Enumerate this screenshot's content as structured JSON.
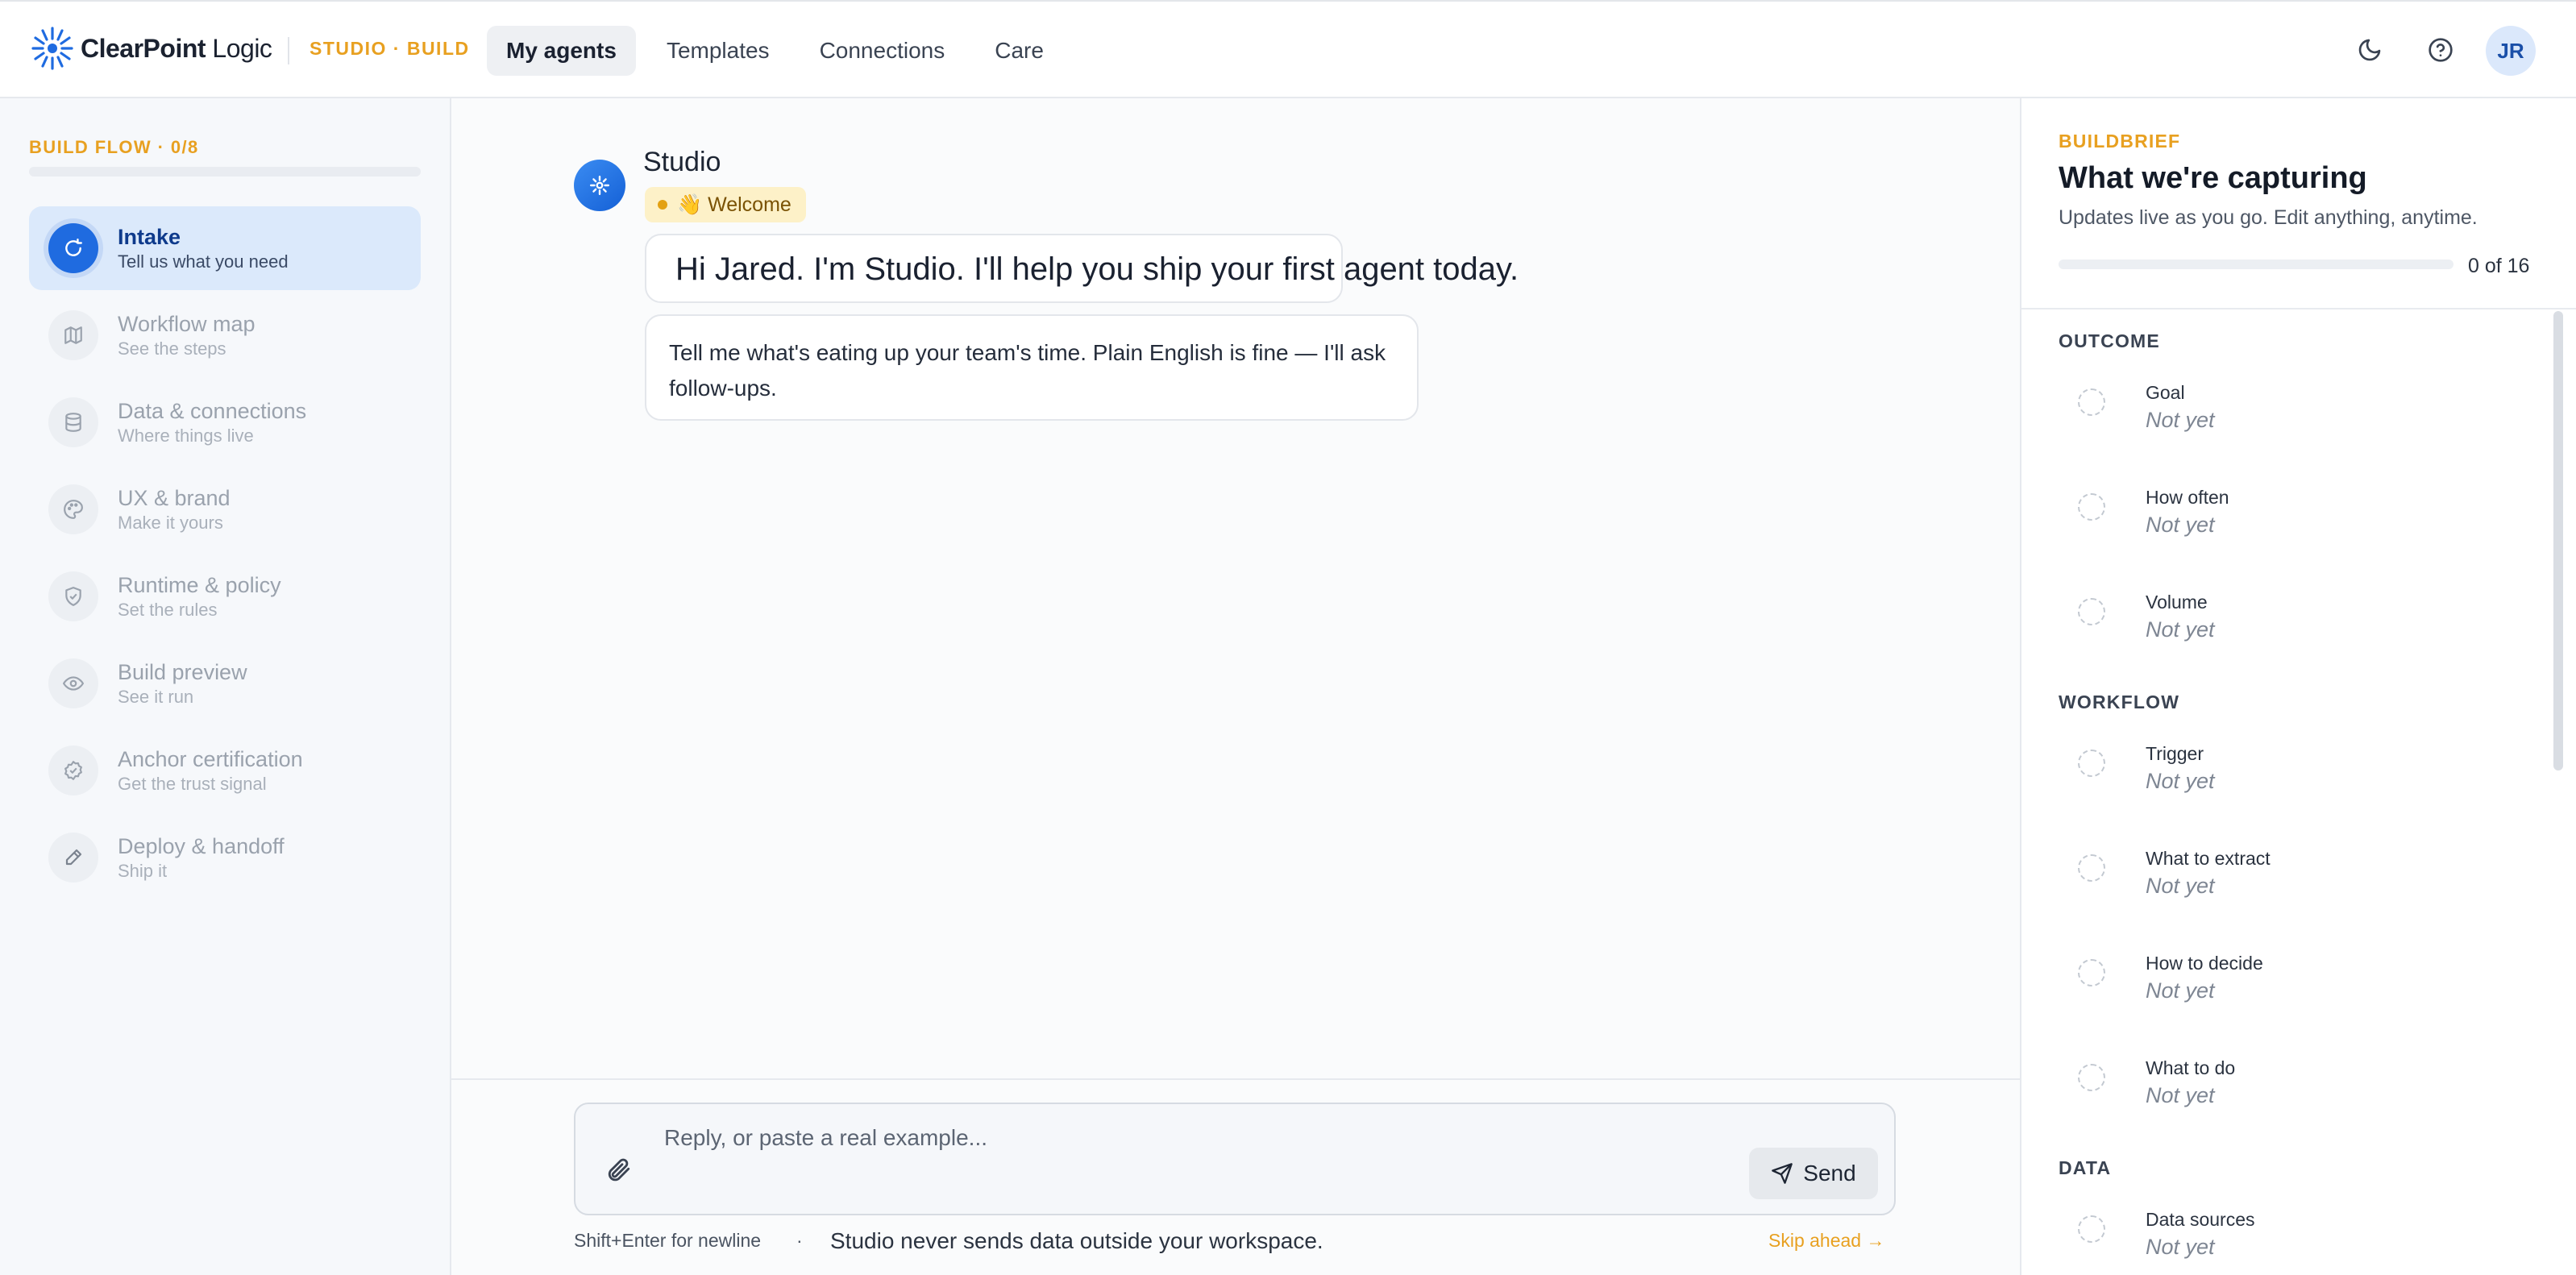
{
  "brand": {
    "name_bold": "ClearPoint",
    "name_rest": " Logic",
    "studio_tag": "STUDIO · BUILD"
  },
  "nav": {
    "tabs": [
      "My agents",
      "Templates",
      "Connections",
      "Care"
    ],
    "active": "My agents"
  },
  "user": {
    "initials": "JR"
  },
  "icons": {
    "theme": "moon-icon",
    "help": "help-circle-icon"
  },
  "sidebar": {
    "flow_label": "BUILD FLOW · 0/8",
    "steps": [
      {
        "title": "Intake",
        "sub": "Tell us what you need",
        "icon": "refresh-icon",
        "active": true
      },
      {
        "title": "Workflow map",
        "sub": "See the steps",
        "icon": "map-icon"
      },
      {
        "title": "Data & connections",
        "sub": "Where things live",
        "icon": "database-icon"
      },
      {
        "title": "UX & brand",
        "sub": "Make it yours",
        "icon": "palette-icon"
      },
      {
        "title": "Runtime & policy",
        "sub": "Set the rules",
        "icon": "shield-icon"
      },
      {
        "title": "Build preview",
        "sub": "See it run",
        "icon": "eye-icon"
      },
      {
        "title": "Anchor certification",
        "sub": "Get the trust signal",
        "icon": "badge-check-icon"
      },
      {
        "title": "Deploy & handoff",
        "sub": "Ship it",
        "icon": "pen-icon"
      }
    ]
  },
  "chat": {
    "bot_name": "Studio",
    "badge": "👋 Welcome",
    "message1": "Hi Jared. I'm Studio. I'll help you ship your first agent today.",
    "message2": "Tell me what's eating up your team's time. Plain English is fine — I'll ask follow-ups."
  },
  "composer": {
    "placeholder": "Reply, or paste a real example...",
    "send_label": "Send",
    "hint": "Shift+Enter for newline",
    "separator": "·",
    "privacy": "Studio never sends data outside your workspace.",
    "skip": "Skip ahead →"
  },
  "brief": {
    "label": "BUILDBRIEF",
    "title": "What we're capturing",
    "subtitle": "Updates live as you go. Edit anything, anytime.",
    "count": "0 of 16",
    "progress": 0,
    "sections": [
      {
        "heading": "OUTCOME",
        "fields": [
          {
            "name": "Goal",
            "value": "Not yet"
          },
          {
            "name": "How often",
            "value": "Not yet"
          },
          {
            "name": "Volume",
            "value": "Not yet"
          }
        ]
      },
      {
        "heading": "WORKFLOW",
        "fields": [
          {
            "name": "Trigger",
            "value": "Not yet"
          },
          {
            "name": "What to extract",
            "value": "Not yet"
          },
          {
            "name": "How to decide",
            "value": "Not yet"
          },
          {
            "name": "What to do",
            "value": "Not yet"
          }
        ]
      },
      {
        "heading": "DATA",
        "fields": [
          {
            "name": "Data sources",
            "value": "Not yet"
          }
        ]
      }
    ]
  },
  "colors": {
    "accent": "#e8a020",
    "primary": "#1f6be0",
    "active_bg": "#dbe9fb"
  }
}
